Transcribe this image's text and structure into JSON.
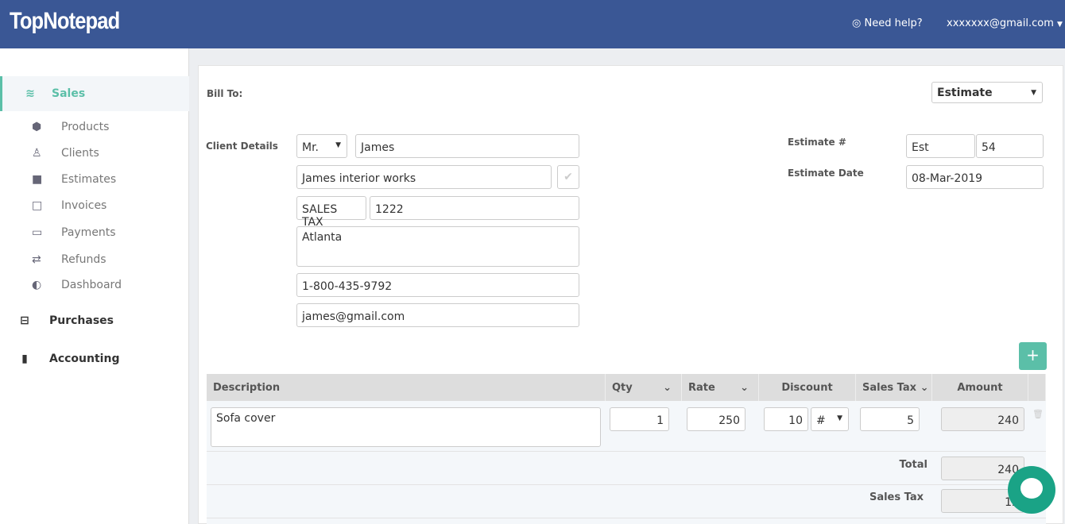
{
  "header": {
    "logo": "TopNotepad",
    "help": "Need help?",
    "user": "xxxxxxx@gmail.com"
  },
  "sidebar": {
    "sales": "Sales",
    "items": [
      "Products",
      "Clients",
      "Estimates",
      "Invoices",
      "Payments",
      "Refunds",
      "Dashboard"
    ],
    "purchases": "Purchases",
    "accounting": "Accounting"
  },
  "form": {
    "bill_to": "Bill To:",
    "doc_type": "Estimate",
    "client_details": "Client Details",
    "salutation": "Mr.",
    "first_name": "James",
    "company": "James interior works",
    "tax_label": "SALES TAX",
    "tax_number": "1222",
    "address": "Atlanta",
    "phone": "1-800-435-9792",
    "email": "james@gmail.com",
    "estimate_no_label": "Estimate #",
    "estimate_prefix": "Est",
    "estimate_no": "54",
    "estimate_date_label": "Estimate Date",
    "estimate_date": "08-Mar-2019"
  },
  "table": {
    "headers": [
      "Description",
      "Qty",
      "Rate",
      "Discount",
      "Sales Tax",
      "Amount"
    ],
    "row": {
      "description": "Sofa cover",
      "qty": "1",
      "rate": "250",
      "discount": "10",
      "discount_type": "#",
      "sales_tax": "5",
      "amount": "240"
    },
    "total_label": "Total",
    "total": "240",
    "sales_tax_label": "Sales Tax",
    "sales_tax": "12"
  },
  "colors": {
    "header": "#3a5795",
    "accent": "#5bbfa8",
    "chat": "#1aa386"
  }
}
